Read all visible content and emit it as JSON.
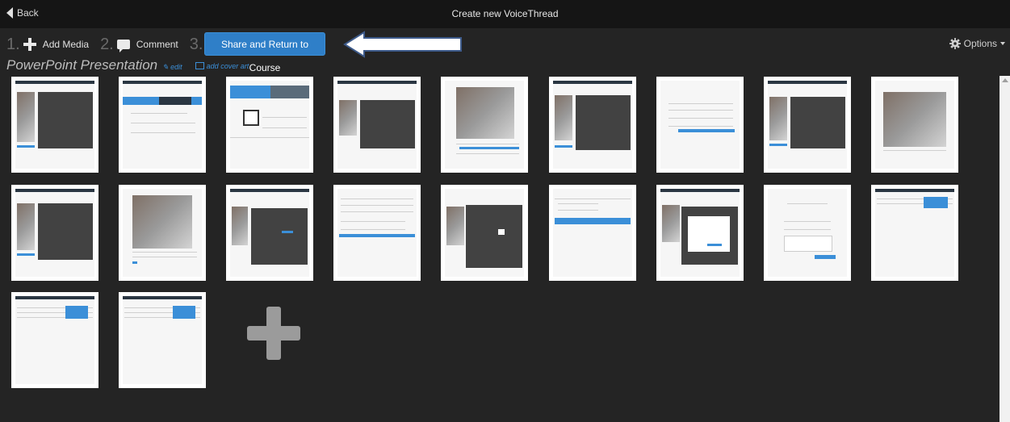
{
  "topbar": {
    "back_label": "Back",
    "title": "Create new VoiceThread"
  },
  "steps": [
    {
      "num": "1.",
      "label": "Add Media",
      "icon": "plus-icon"
    },
    {
      "num": "2.",
      "label": "Comment",
      "icon": "comment-icon"
    },
    {
      "num": "3.",
      "label": "Share and Return to Course",
      "icon": ""
    }
  ],
  "options_label": "Options",
  "presentation": {
    "title": "PowerPoint Presentation",
    "edit_label": "edit",
    "cover_label": "add cover art"
  },
  "colors": {
    "accent": "#2f7fc8",
    "background": "#242424",
    "topbar": "#151515"
  },
  "slides_count_visible": 20
}
